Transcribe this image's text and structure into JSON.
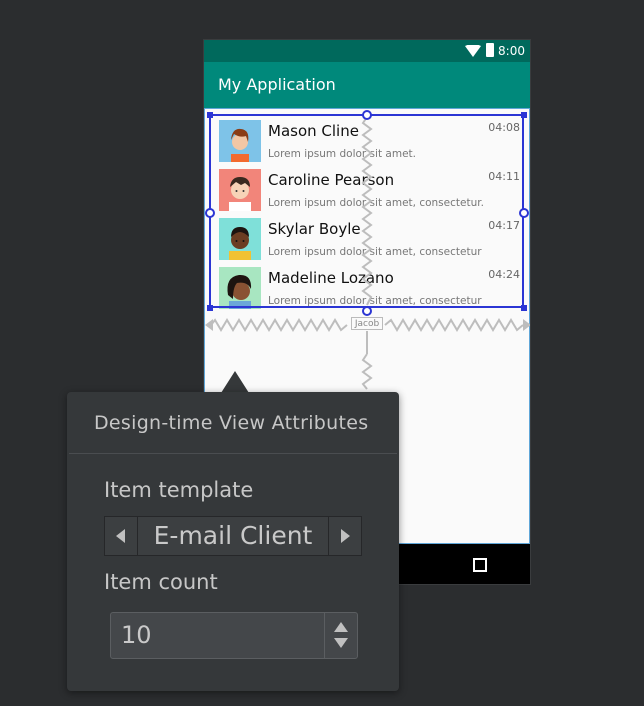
{
  "app": {
    "status_time": "8:00",
    "title": "My Application"
  },
  "list": {
    "items": [
      {
        "name": "Mason Cline",
        "time": "04:08",
        "snippet": "Lorem ipsum dolor sit amet.",
        "avatar_color": "#7ec3e8"
      },
      {
        "name": "Caroline Pearson",
        "time": "04:11",
        "snippet": "Lorem ipsum dolor sit amet, consectetur.",
        "avatar_color": "#f2857a"
      },
      {
        "name": "Skylar Boyle",
        "time": "04:17",
        "snippet": "Lorem ipsum dolor sit amet, consectetur",
        "avatar_color": "#7fe0d9"
      },
      {
        "name": "Madeline Lozano",
        "time": "04:24",
        "snippet": "Lorem ipsum dolor sit amet, consectetur",
        "avatar_color": "#a8e6c1"
      }
    ],
    "constraint_label": "Jacob"
  },
  "popup": {
    "title": "Design-time View Attributes",
    "template_label": "Item template",
    "template_value": "E-mail Client",
    "count_label": "Item count",
    "count_value": "10"
  },
  "colors": {
    "accent": "#00897b",
    "status_bar": "#00695c",
    "selection": "#2b35d4"
  }
}
